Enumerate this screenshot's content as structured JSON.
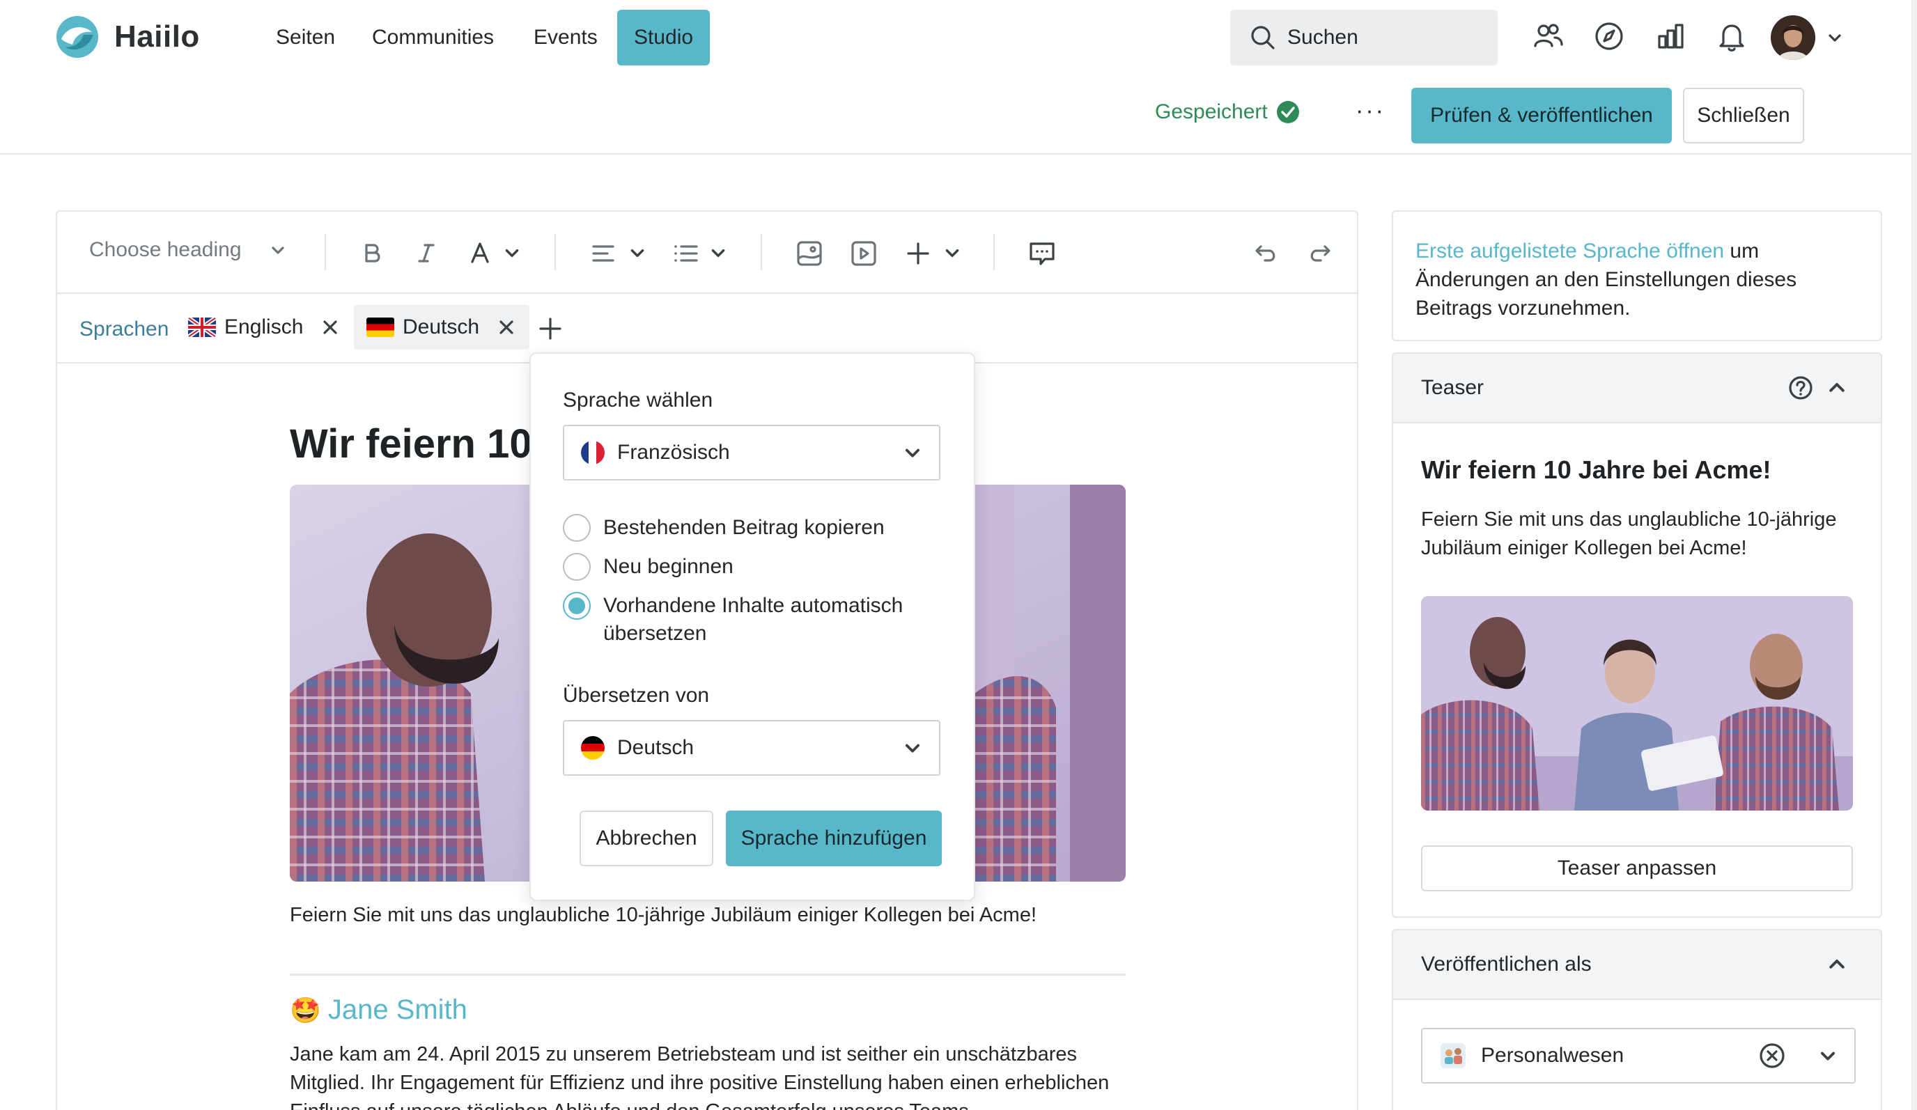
{
  "app": {
    "name": "Haiilo"
  },
  "nav": {
    "items": [
      {
        "label": "Seiten"
      },
      {
        "label": "Communities"
      },
      {
        "label": "Events"
      },
      {
        "label": "Studio",
        "active": true
      }
    ]
  },
  "search": {
    "placeholder": "Suchen"
  },
  "header_icons": [
    "people-icon",
    "compass-icon",
    "analytics-icon",
    "bell-icon"
  ],
  "status": {
    "saved_label": "Gespeichert"
  },
  "actions": {
    "more": "···",
    "publish_label": "Prüfen & veröffentlichen",
    "close_label": "Schließen"
  },
  "toolbar": {
    "heading_placeholder": "Choose heading"
  },
  "languages": {
    "label": "Sprachen",
    "tags": [
      {
        "label": "Englisch",
        "flag": "uk"
      },
      {
        "label": "Deutsch",
        "flag": "de",
        "active": true
      }
    ]
  },
  "post": {
    "title": "Wir feiern 10 .",
    "caption": "Feiern Sie mit uns das unglaubliche 10-jährige Jubiläum einiger Kollegen bei Acme!",
    "author_emoji": "🤩",
    "author_name": "Jane Smith",
    "author_text": "Jane kam am 24. April 2015 zu unserem Betriebsteam und ist seither ein unschätzbares Mitglied. Ihr Engagement für Effizienz und ihre positive Einstellung haben einen erheblichen Einfluss auf unsere täglichen Abläufe und den Gesamterfolg unseres Teams."
  },
  "language_popover": {
    "choose_label": "Sprache wählen",
    "selected_language": "Französisch",
    "options": [
      {
        "label": "Bestehenden Beitrag kopieren",
        "selected": false
      },
      {
        "label": "Neu beginnen",
        "selected": false
      },
      {
        "label": "Vorhandene Inhalte automatisch übersetzen",
        "selected": true
      }
    ],
    "translate_from_label": "Übersetzen von",
    "translate_from_value": "Deutsch",
    "cancel_label": "Abbrechen",
    "add_label": "Sprache hinzufügen"
  },
  "sidebar": {
    "hint_link": "Erste aufgelistete Sprache öffnen",
    "hint_text": " um Änderungen an den Einstellungen dieses Beitrags vorzunehmen.",
    "teaser": {
      "header": "Teaser",
      "title": "Wir feiern 10 Jahre bei Acme!",
      "description": "Feiern Sie mit uns das unglaubliche 10-jährige Jubiläum einiger Kollegen bei Acme!",
      "adjust_label": "Teaser anpassen"
    },
    "publish_as": {
      "header": "Veröffentlichen als",
      "value": "Personalwesen"
    }
  },
  "colors": {
    "accent": "#58b7c9",
    "saved_green": "#2e8b57",
    "link_blue": "#3c7d9a"
  }
}
